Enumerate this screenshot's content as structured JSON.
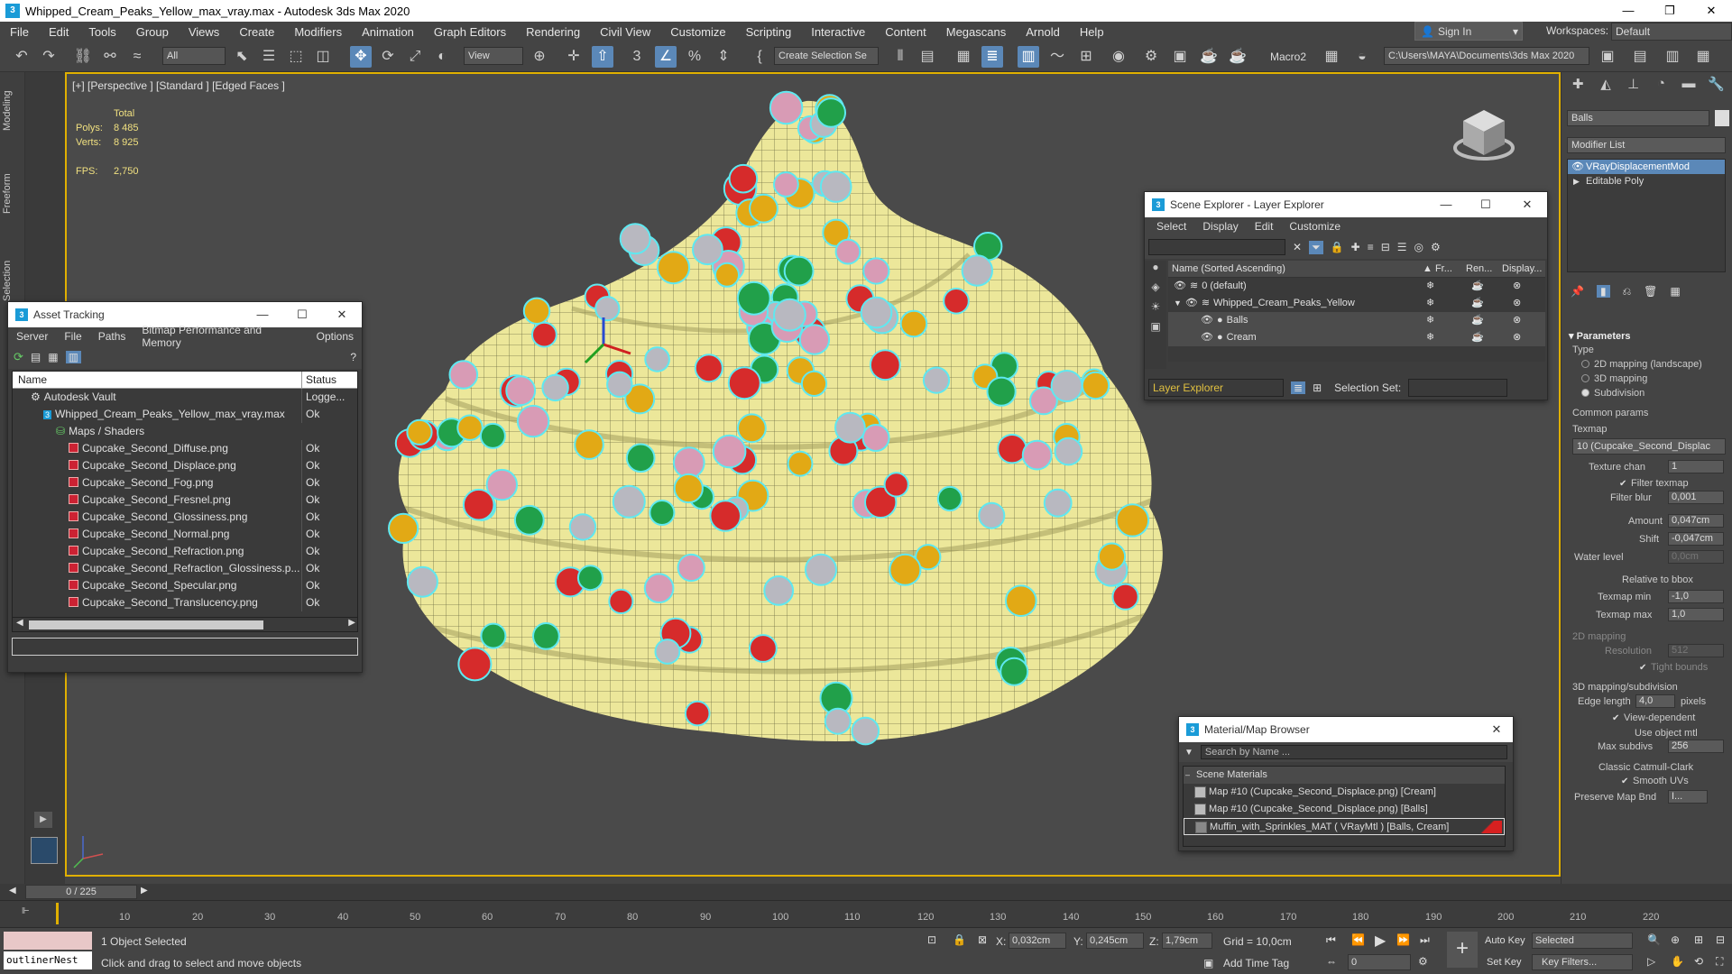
{
  "window": {
    "title": "Whipped_Cream_Peaks_Yellow_max_vray.max - Autodesk 3ds Max 2020"
  },
  "menu": [
    "File",
    "Edit",
    "Tools",
    "Group",
    "Views",
    "Create",
    "Modifiers",
    "Animation",
    "Graph Editors",
    "Rendering",
    "Civil View",
    "Customize",
    "Scripting",
    "Interactive",
    "Content",
    "Megascans",
    "Arnold",
    "Help"
  ],
  "account": {
    "sign_in": "Sign In",
    "workspaces_label": "Workspaces:",
    "workspace": "Default"
  },
  "toolbar": {
    "filter": "All",
    "ref_coord": "View",
    "selection_set": "Create Selection Se",
    "macro": "Macro2",
    "project_path": "C:\\Users\\MAYA\\Documents\\3ds Max 2020"
  },
  "ribbon_tabs": [
    "Modeling",
    "Freeform",
    "Selection"
  ],
  "viewport": {
    "label": "[+] [Perspective ] [Standard ] [Edged Faces ]",
    "stats": {
      "total_label": "Total",
      "polys_label": "Polys:",
      "polys": "8 485",
      "verts_label": "Verts:",
      "verts": "8 925",
      "fps_label": "FPS:",
      "fps": "2,750"
    },
    "colors": {
      "cream": "#ece79a",
      "red": "#d62b2b",
      "yellow": "#e2a915",
      "green": "#21a04a",
      "grey": "#b8b8c0",
      "pink": "#d89bb5",
      "selection": "#5fe8f0"
    }
  },
  "asset_tracking": {
    "title": "Asset Tracking",
    "menu": [
      "Server",
      "File",
      "Paths",
      "Bitmap Performance and Memory",
      "Options"
    ],
    "columns": {
      "name": "Name",
      "status": "Status"
    },
    "rows": [
      {
        "name": "Autodesk Vault",
        "status": "Logge...",
        "indent": 1
      },
      {
        "name": "Whipped_Cream_Peaks_Yellow_max_vray.max",
        "status": "Ok",
        "indent": 2
      },
      {
        "name": "Maps / Shaders",
        "status": "",
        "indent": 3
      },
      {
        "name": "Cupcake_Second_Diffuse.png",
        "status": "Ok",
        "indent": 4
      },
      {
        "name": "Cupcake_Second_Displace.png",
        "status": "Ok",
        "indent": 4
      },
      {
        "name": "Cupcake_Second_Fog.png",
        "status": "Ok",
        "indent": 4
      },
      {
        "name": "Cupcake_Second_Fresnel.png",
        "status": "Ok",
        "indent": 4
      },
      {
        "name": "Cupcake_Second_Glossiness.png",
        "status": "Ok",
        "indent": 4
      },
      {
        "name": "Cupcake_Second_Normal.png",
        "status": "Ok",
        "indent": 4
      },
      {
        "name": "Cupcake_Second_Refraction.png",
        "status": "Ok",
        "indent": 4
      },
      {
        "name": "Cupcake_Second_Refraction_Glossiness.p...",
        "status": "Ok",
        "indent": 4
      },
      {
        "name": "Cupcake_Second_Specular.png",
        "status": "Ok",
        "indent": 4
      },
      {
        "name": "Cupcake_Second_Translucency.png",
        "status": "Ok",
        "indent": 4
      }
    ]
  },
  "scene_explorer": {
    "title": "Scene Explorer - Layer Explorer",
    "menu": [
      "Select",
      "Display",
      "Edit",
      "Customize"
    ],
    "columns": {
      "name": "Name (Sorted Ascending)",
      "freeze": "▲ Fr...",
      "render": "Ren...",
      "display": "Display..."
    },
    "rows": [
      {
        "name": "0 (default)",
        "level": 0
      },
      {
        "name": "Whipped_Cream_Peaks_Yellow",
        "level": 0
      },
      {
        "name": "Balls",
        "level": 1
      },
      {
        "name": "Cream",
        "level": 1
      }
    ],
    "explorer": "Layer Explorer",
    "selection_set_label": "Selection Set:"
  },
  "material_browser": {
    "title": "Material/Map Browser",
    "search_placeholder": "Search by Name ...",
    "group": "Scene Materials",
    "items": [
      "Map #10 (Cupcake_Second_Displace.png) [Cream]",
      "Map #10 (Cupcake_Second_Displace.png) [Balls]",
      "Muffin_with_Sprinkles_MAT ( VRayMtl ) [Balls, Cream]"
    ]
  },
  "command_panel": {
    "object_name": "Balls",
    "modifier_list": "Modifier List",
    "stack": [
      "VRayDisplacementMod",
      "Editable Poly"
    ],
    "parameters": {
      "header": "Parameters",
      "type_label": "Type",
      "type_options": [
        "2D mapping (landscape)",
        "3D mapping",
        "Subdivision"
      ],
      "common_label": "Common params",
      "texmap_label": "Texmap",
      "texmap": "10 (Cupcake_Second_Displac",
      "texture_chan_label": "Texture chan",
      "texture_chan": "1",
      "filter_texmap": "Filter texmap",
      "filter_blur_label": "Filter blur",
      "filter_blur": "0,001",
      "amount_label": "Amount",
      "amount": "0,047cm",
      "shift_label": "Shift",
      "shift": "-0,047cm",
      "water_level_label": "Water level",
      "water_level": "0,0cm",
      "relative_bbox": "Relative to bbox",
      "texmap_min_label": "Texmap min",
      "texmap_min": "-1,0",
      "texmap_max_label": "Texmap max",
      "texmap_max": "1,0",
      "map2d_label": "2D mapping",
      "resolution_label": "Resolution",
      "resolution": "512",
      "tight_bounds": "Tight bounds",
      "map3d_label": "3D mapping/subdivision",
      "edge_length_label": "Edge length",
      "edge_length": "4,0",
      "pixels": "pixels",
      "view_dependent": "View-dependent",
      "use_object_mtl": "Use object mtl",
      "max_subdivs_label": "Max subdivs",
      "max_subdivs": "256",
      "classic_catmull": "Classic Catmull-Clark",
      "smooth_uvs": "Smooth UVs",
      "preserve_map_label": "Preserve Map Bnd",
      "preserve_map": "I..."
    }
  },
  "timeline": {
    "frame": "0 / 225",
    "ticks": [
      "10",
      "20",
      "30",
      "40",
      "50",
      "60",
      "70",
      "80",
      "90",
      "100",
      "110",
      "120",
      "130",
      "140",
      "150",
      "160",
      "170",
      "180",
      "190",
      "200",
      "210",
      "220"
    ]
  },
  "status": {
    "script_listener": "outlinerNest",
    "selected": "1 Object Selected",
    "prompt": "Click and drag to select and move objects",
    "x_label": "X:",
    "x": "0,032cm",
    "y_label": "Y:",
    "y": "0,245cm",
    "z_label": "Z:",
    "z": "1,79cm",
    "grid": "Grid = 10,0cm",
    "add_time_tag": "Add Time Tag",
    "auto_key": "Auto Key",
    "set_key": "Set Key",
    "key_mode": "Selected",
    "key_filters": "Key Filters...",
    "current_frame": "0"
  }
}
